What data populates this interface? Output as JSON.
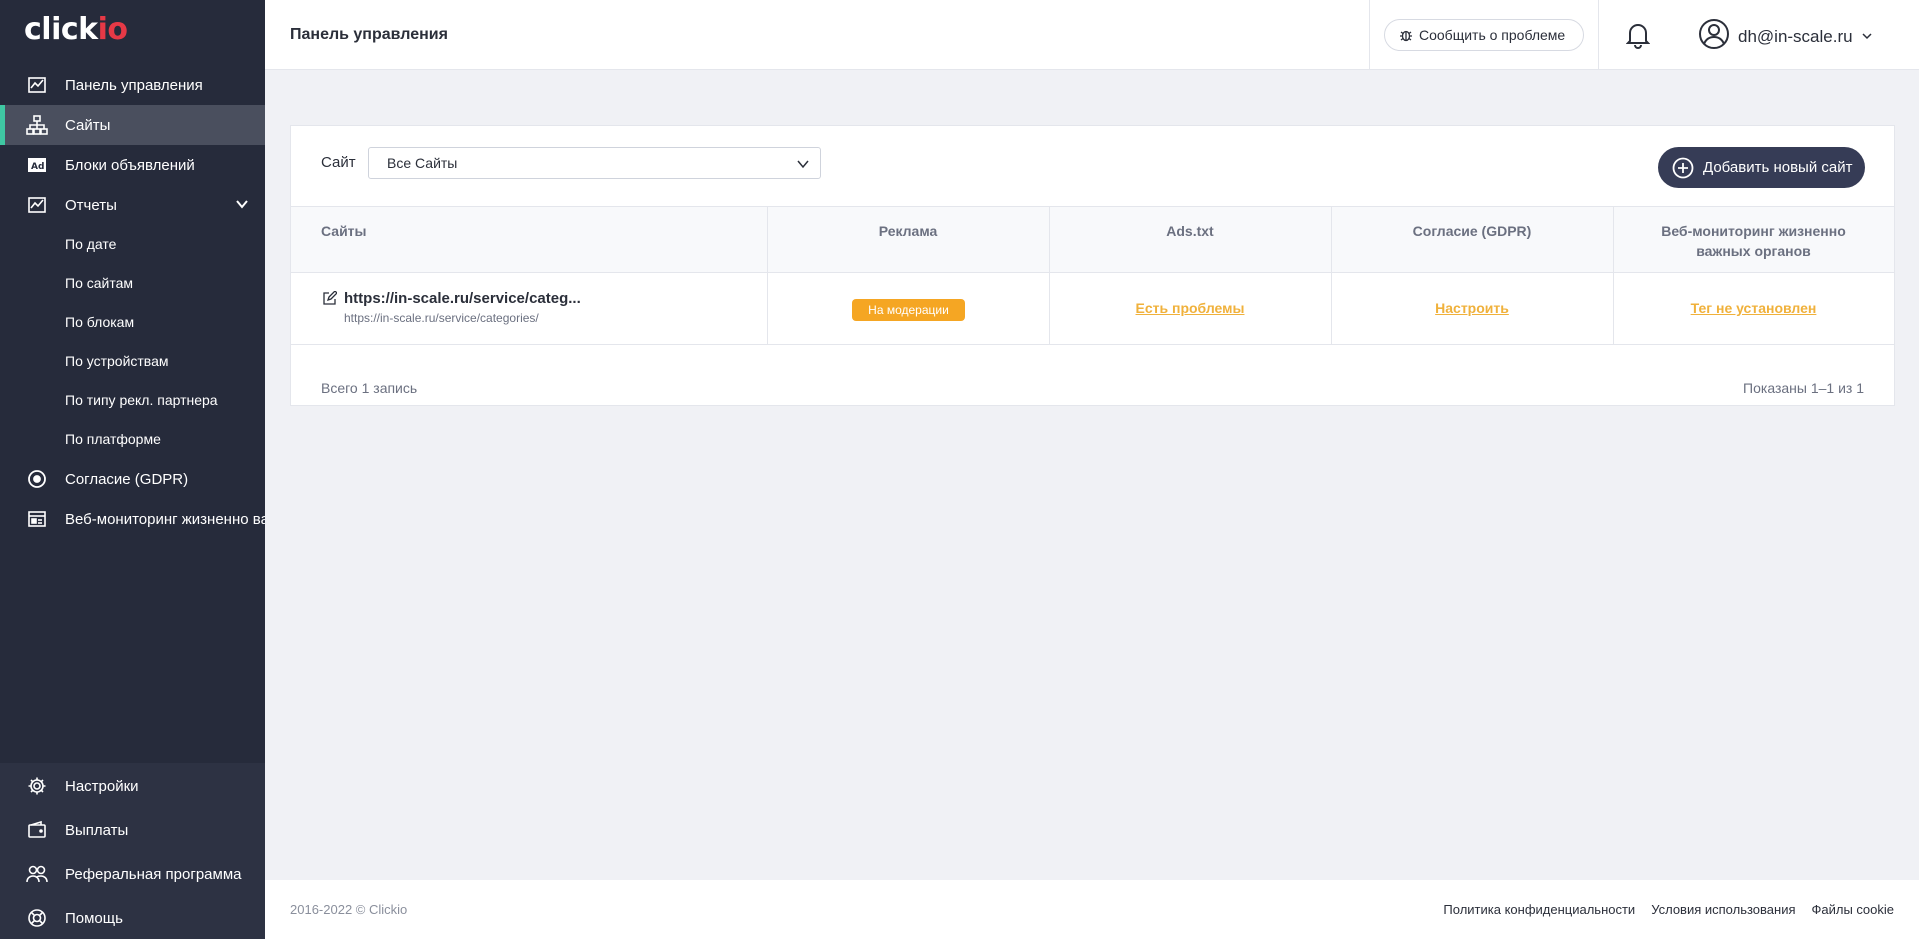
{
  "brand": {
    "logo_main": "click",
    "logo_accent": "io"
  },
  "sidebar": {
    "items": [
      {
        "label": "Панель управления",
        "icon": "chart-line-icon"
      },
      {
        "label": "Сайты",
        "icon": "sitemap-icon",
        "active": true
      },
      {
        "label": "Блоки объявлений",
        "icon": "ad-icon"
      },
      {
        "label": "Отчеты",
        "icon": "report-chart-icon",
        "expanded": true
      }
    ],
    "report_sub": [
      "По дате",
      "По сайтам",
      "По блокам",
      "По устройствам",
      "По типу рекл. партнера",
      "По платформе"
    ],
    "extra": [
      {
        "label": "Согласие (GDPR)",
        "icon": "consent-icon"
      },
      {
        "label": "Веб-мониторинг жизненно ва",
        "icon": "monitor-icon"
      }
    ],
    "bottom": [
      {
        "label": "Настройки",
        "icon": "gear-icon"
      },
      {
        "label": "Выплаты",
        "icon": "wallet-icon"
      },
      {
        "label": "Реферальная программа",
        "icon": "users-icon"
      },
      {
        "label": "Помощь",
        "icon": "lifebuoy-icon"
      }
    ]
  },
  "header": {
    "title": "Панель управления",
    "report_label": "Сообщить о проблеме",
    "user_email": "dh@in-scale.ru"
  },
  "filter": {
    "label": "Сайт",
    "selected": "Все Сайты"
  },
  "add_button": "Добавить новый сайт",
  "table": {
    "headers": [
      "Сайты",
      "Реклама",
      "Ads.txt",
      "Согласие (GDPR)",
      "Веб-мониторинг жизненно важных органов"
    ],
    "rows": [
      {
        "site_title": "https://in-scale.ru/service/categ...",
        "site_url": "https://in-scale.ru/service/categories/",
        "ads_status": "На модерации",
        "adstxt": "Есть проблемы",
        "gdpr": "Настроить",
        "monitoring": "Тег не установлен"
      }
    ],
    "total": "Всего 1 запись",
    "shown": "Показаны 1–1 из 1"
  },
  "footer": {
    "copyright": "2016-2022 © Clickio",
    "links": [
      "Политика конфиденциальности",
      "Условия использования",
      "Файлы cookie"
    ]
  },
  "colors": {
    "sidebar_bg": "#262b3b",
    "active_accent": "#3fc7a2",
    "badge": "#f5a623",
    "link": "#f0b13b",
    "button": "#363c56"
  }
}
